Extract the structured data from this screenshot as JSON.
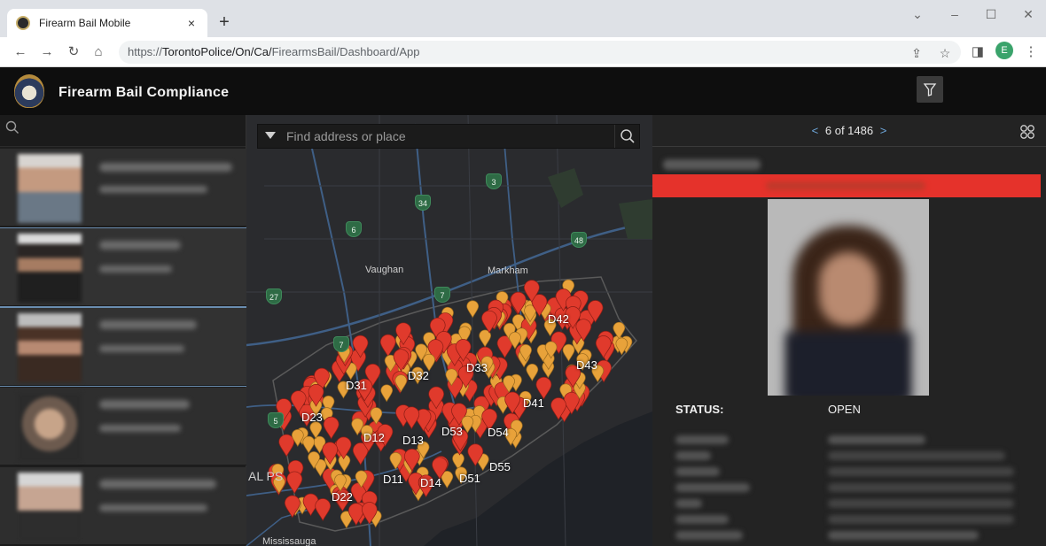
{
  "browser": {
    "tab_title": "Firearm Bail Mobile",
    "tab_close": "×",
    "new_tab": "+",
    "url_prefix": "https://",
    "url_host": "TorontoPolice/On/Ca/",
    "url_path": "FirearmsBail/Dashboard/App",
    "profile_initial": "E",
    "win_minimize": "–",
    "win_maximize": "☐",
    "win_close": "✕",
    "win_dropdown": "⌄"
  },
  "app": {
    "title": "Firearm Bail Compliance"
  },
  "map": {
    "search_placeholder": "Find address or place",
    "places": [
      "Vaughan",
      "Markham",
      "AL PS",
      "Mississauga"
    ],
    "districts": [
      "D42",
      "D43",
      "D33",
      "D32",
      "D31",
      "D41",
      "D23",
      "D12",
      "D13",
      "D53",
      "D54",
      "D55",
      "D11",
      "D14",
      "D51",
      "D22"
    ],
    "highway_shields": [
      "3",
      "34",
      "6",
      "48",
      "27",
      "7",
      "7",
      "5"
    ]
  },
  "detail": {
    "pager_text": "6 of 1486",
    "prev": "<",
    "next": ">",
    "status_label": "STATUS:",
    "status_value": "OPEN"
  },
  "colors": {
    "banner": "#e5322b",
    "marker_red": "#e03a2c",
    "marker_orange": "#e8a23a",
    "accent": "#6fa8dc"
  }
}
